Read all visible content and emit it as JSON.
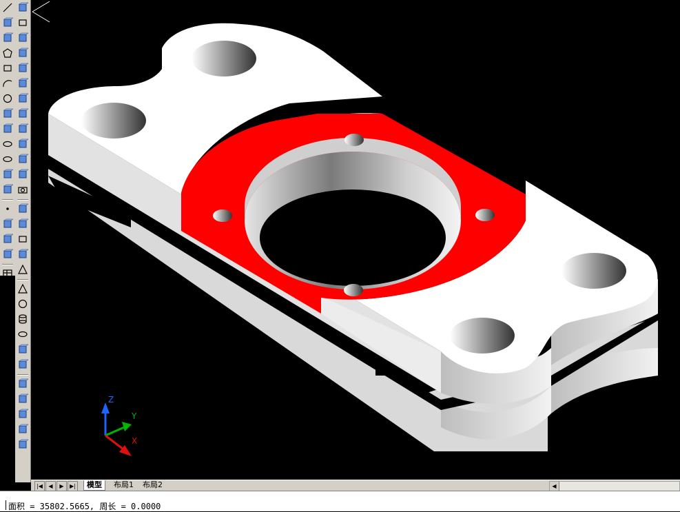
{
  "model_tabs": [
    {
      "label": "模型",
      "active": true
    },
    {
      "label": "布局1",
      "active": false
    },
    {
      "label": "布局2",
      "active": false
    }
  ],
  "ucs": {
    "z_label": "Z",
    "y_label": "Y",
    "x_label": "X"
  },
  "command_line": {
    "text": "面积 = 35802.5665, 周长 = 0.0000"
  },
  "draw_toolbar_icons": [
    "line-icon",
    "construction-line-icon",
    "polyline-icon",
    "polygon-icon",
    "rectangle-icon",
    "arc-icon",
    "circle-icon",
    "revision-cloud-icon",
    "spline-icon",
    "ellipse-icon",
    "ellipse-arc-icon",
    "insert-block-icon",
    "make-block-icon",
    "point-icon",
    "hatch-icon",
    "gradient-icon",
    "region-icon",
    "table-icon",
    "multiline-text-icon"
  ],
  "solids_toolbar_icons": [
    "view-icon",
    "box-icon",
    "top-view-icon",
    "bottom-view-icon",
    "left-view-icon",
    "right-view-icon",
    "front-view-icon",
    "back-view-icon",
    "sw-iso-icon",
    "se-iso-icon",
    "ne-iso-icon",
    "nw-iso-icon",
    "camera-icon",
    "extrude-icon",
    "revolve-icon",
    "box-solid-icon",
    "wedge-icon",
    "pyramid-icon",
    "cone-icon",
    "sphere-icon",
    "cylinder-icon",
    "torus-icon",
    "planar-surface-icon",
    "mesh-icon",
    "union-icon",
    "subtract-icon",
    "sweep-icon",
    "loft-icon",
    "presspull-icon"
  ],
  "colors": {
    "highlight_face": "#ff0000",
    "solid": "#ffffff",
    "background": "#000000",
    "toolbar": "#d4d0c8"
  }
}
